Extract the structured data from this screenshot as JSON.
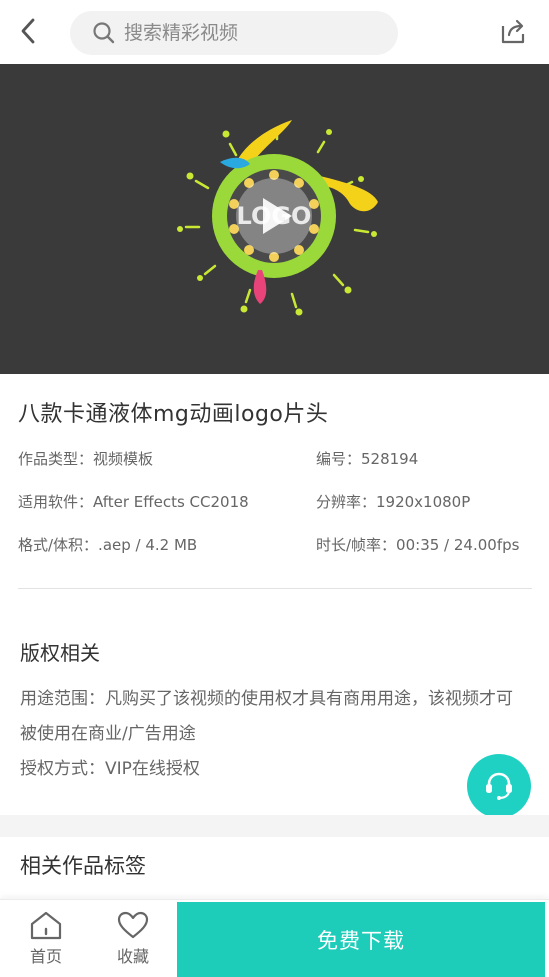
{
  "header": {
    "search_placeholder": "搜索精彩视频",
    "back_icon": "chevron-left-icon",
    "share_icon": "share-icon"
  },
  "video": {
    "thumbnail_text": "LOGO",
    "play_icon": "play-icon"
  },
  "product": {
    "title": "八款卡通液体mg动画logo片头",
    "meta": [
      {
        "left": "作品类型：视频模板",
        "right": "编号：528194"
      },
      {
        "left": "适用软件：After Effects CC2018",
        "right": "分辨率：1920x1080P"
      },
      {
        "left": "格式/体积：.aep / 4.2 MB",
        "right": "时长/帧率：00:35 / 24.00fps"
      }
    ]
  },
  "copyright": {
    "title": "版权相关",
    "usage": "用途范围：凡购买了该视频的使用权才具有商用用途，该视频才可被使用在商业/广告用途",
    "license": "授权方式：VIP在线授权"
  },
  "tags": {
    "title": "相关作品标签"
  },
  "bottom_bar": {
    "home_label": "首页",
    "favorite_label": "收藏",
    "download_label": "免费下载"
  },
  "colors": {
    "accent": "#1dcdb9",
    "video_bg": "#3a3a3a"
  }
}
